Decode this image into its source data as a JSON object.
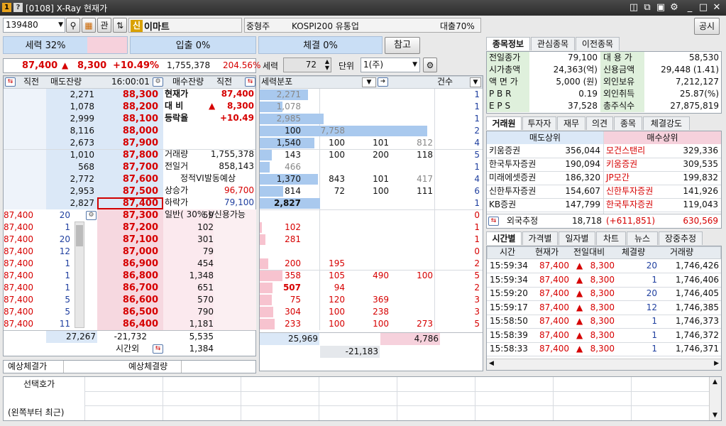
{
  "window": {
    "badge1": "1",
    "badge2": "?",
    "title": "[0108] X-Ray 현재가",
    "icons": [
      "window-pin-icon",
      "copy-icon",
      "screenshot-icon",
      "gear-icon"
    ],
    "min": "_",
    "max": "□",
    "close": "✕"
  },
  "toolbar": {
    "code": "139480",
    "gwan": "관",
    "sin_badge": "신",
    "stock_name": "이마트",
    "type": "중형주",
    "sector": "KOSPI200 유통업",
    "loan": "대출70%",
    "notice": "공시"
  },
  "power_bars": {
    "power": "세력 32%",
    "in_out": "입출 0%",
    "trade": "체결 0%",
    "ref": "참고"
  },
  "summary": {
    "price": "87,400",
    "arrow": "▲",
    "change": "8,300",
    "rate": "+10.49%",
    "volume": "1,755,378",
    "ratio": "204.56%"
  },
  "force_ctrl": {
    "label": "세력",
    "value": "72",
    "unit_label": "단위",
    "unit_value": "1(주)"
  },
  "ob_head": {
    "c1": "직전",
    "c2": "매도잔량",
    "time": "16:00:01",
    "c4": "매수잔량",
    "c5": "직전"
  },
  "asks": [
    {
      "qty": "2,271",
      "price": "88,300"
    },
    {
      "qty": "1,078",
      "price": "88,200"
    },
    {
      "qty": "2,999",
      "price": "88,100"
    },
    {
      "qty": "8,116",
      "price": "88,000"
    },
    {
      "qty": "2,673",
      "price": "87,900"
    },
    {
      "qty": "1,010",
      "price": "87,800"
    },
    {
      "qty": "568",
      "price": "87,700"
    },
    {
      "qty": "2,772",
      "price": "87,600"
    },
    {
      "qty": "2,953",
      "price": "87,500"
    },
    {
      "qty": "2,827",
      "price": "87,400"
    }
  ],
  "bids": [
    {
      "tp": "87,400",
      "tq": "20",
      "price": "87,300",
      "qty": "59"
    },
    {
      "tp": "87,400",
      "tq": "1",
      "price": "87,200",
      "qty": "102"
    },
    {
      "tp": "87,400",
      "tq": "20",
      "price": "87,100",
      "qty": "301"
    },
    {
      "tp": "87,400",
      "tq": "12",
      "price": "87,000",
      "qty": "79"
    },
    {
      "tp": "87,400",
      "tq": "1",
      "price": "86,900",
      "qty": "454"
    },
    {
      "tp": "87,400",
      "tq": "1",
      "price": "86,800",
      "qty": "1,348"
    },
    {
      "tp": "87,400",
      "tq": "1",
      "price": "86,700",
      "qty": "651"
    },
    {
      "tp": "87,400",
      "tq": "5",
      "price": "86,600",
      "qty": "570"
    },
    {
      "tp": "87,400",
      "tq": "5",
      "price": "86,500",
      "qty": "790"
    },
    {
      "tp": "87,400",
      "tq": "11",
      "price": "86,400",
      "qty": "1,181"
    }
  ],
  "ob_info": {
    "cur_label": "현재가",
    "cur_val": "87,400",
    "diff_label": "대  비",
    "diff_arrow": "▲",
    "diff_val": "8,300",
    "rate_label": "등락율",
    "rate_val": "+10.49",
    "vol_label": "거래량",
    "vol_val": "1,755,378",
    "prev_label": "전일거",
    "prev_val": "858,143",
    "vi_label": "정적VI발동예상",
    "up_label": "상승가",
    "up_val": "96,700",
    "down_label": "하락가",
    "down_val": "79,100",
    "margin_label": "일반( 30% )/신용가능"
  },
  "ob_totals": {
    "ask_total": "27,267",
    "diff": "-21,732",
    "bid_total": "5,535",
    "after_label": "시간외",
    "after_val": "1,384"
  },
  "expected": {
    "price_label": "예상체결가",
    "price_val": "",
    "qty_label": "예상체결량",
    "qty_val": ""
  },
  "dist": {
    "label": "세력분포",
    "count_label": "건수",
    "rows": [
      {
        "a": "2,271",
        "b": "",
        "c": "",
        "d": "",
        "n": "1"
      },
      {
        "a": "1,078",
        "b": "",
        "c": "",
        "d": "",
        "n": "1"
      },
      {
        "a": "2,985",
        "b": "",
        "c": "",
        "d": "",
        "n": "1"
      },
      {
        "a": "100",
        "b": "7,758",
        "c": "",
        "d": "",
        "n": "2"
      },
      {
        "a": "1,540",
        "b": "100",
        "c": "101",
        "d": "812",
        "n": "4"
      },
      {
        "a": "143",
        "b": "100",
        "c": "200",
        "d": "118",
        "n": "5"
      },
      {
        "a": "466",
        "b": "",
        "c": "",
        "d": "",
        "n": "1"
      },
      {
        "a": "1,370",
        "b": "843",
        "c": "101",
        "d": "417",
        "n": "4"
      },
      {
        "a": "814",
        "b": "72",
        "c": "100",
        "d": "111",
        "n": "6"
      },
      {
        "a": "2,827",
        "b": "",
        "c": "",
        "d": "",
        "n": "1"
      },
      {
        "a": "",
        "b": "",
        "c": "",
        "d": "",
        "n": "0"
      },
      {
        "a": "102",
        "b": "",
        "c": "",
        "d": "",
        "n": "1"
      },
      {
        "a": "281",
        "b": "",
        "c": "",
        "d": "",
        "n": "1"
      },
      {
        "a": "",
        "b": "",
        "c": "",
        "d": "",
        "n": "0"
      },
      {
        "a": "200",
        "b": "195",
        "c": "",
        "d": "",
        "n": "2"
      },
      {
        "a": "358",
        "b": "105",
        "c": "490",
        "d": "100",
        "n": "5"
      },
      {
        "a": "507",
        "b": "94",
        "c": "",
        "d": "",
        "n": "2"
      },
      {
        "a": "75",
        "b": "120",
        "c": "369",
        "d": "",
        "n": "3"
      },
      {
        "a": "304",
        "b": "100",
        "c": "238",
        "d": "",
        "n": "3"
      },
      {
        "a": "233",
        "b": "100",
        "c": "100",
        "d": "273",
        "n": "5"
      }
    ],
    "total_ask": "25,969",
    "total_bid": "4,786",
    "total_diff": "-21,183"
  },
  "info_tabs": [
    "종목정보",
    "관심종목",
    "이전종목"
  ],
  "info": [
    {
      "l1": "전일종가",
      "v1": "79,100",
      "l2": "대 용 가",
      "v2": "58,530"
    },
    {
      "l1": "시가총액",
      "v1": "24,363(억)",
      "l2": "신용금액",
      "v2": "29,448  (1.41)"
    },
    {
      "l1": "액 면 가",
      "v1": "5,000 (원)",
      "l2": "외인보유",
      "v2": "7,212,127"
    },
    {
      "l1": "P B R",
      "v1": "0.19",
      "l2": "외인취득",
      "v2": "25.87(%)"
    },
    {
      "l1": "E P S",
      "v1": "37,528",
      "l2": "총주식수",
      "v2": "27,875,819"
    }
  ],
  "broker_tabs": [
    "거래원",
    "투자자",
    "재무",
    "의견",
    "종목",
    "체결강도"
  ],
  "broker": {
    "sell_head": "매도상위",
    "buy_head": "매수상위",
    "rows": [
      {
        "sn": "키움증권",
        "sv": "356,044",
        "bn": "모건스탠리",
        "bv": "329,336"
      },
      {
        "sn": "한국투자증권",
        "sv": "190,094",
        "bn": "키움증권",
        "bv": "309,535"
      },
      {
        "sn": "미래에셋증권",
        "sv": "186,320",
        "bn": "JP모간",
        "bv": "199,832"
      },
      {
        "sn": "신한투자증권",
        "sv": "154,607",
        "bn": "신한투자증권",
        "bv": "141,926"
      },
      {
        "sn": "KB증권",
        "sv": "147,799",
        "bn": "한국투자증권",
        "bv": "119,043"
      }
    ],
    "foreign_label": "외국추정",
    "foreign_sell": "18,718",
    "foreign_diff": "(+611,851)",
    "foreign_buy": "630,569"
  },
  "time_tabs": [
    "시간별",
    "가격별",
    "일자별",
    "차트",
    "뉴스",
    "장중추정"
  ],
  "time_head": {
    "t": "시간",
    "p": "현재가",
    "d": "전일대비",
    "q": "체결량",
    "v": "거래량"
  },
  "time_rows": [
    {
      "t": "15:59:34",
      "p": "87,400",
      "d": "8,300",
      "q": "20",
      "v": "1,746,426"
    },
    {
      "t": "15:59:34",
      "p": "87,400",
      "d": "8,300",
      "q": "1",
      "v": "1,746,406"
    },
    {
      "t": "15:59:20",
      "p": "87,400",
      "d": "8,300",
      "q": "20",
      "v": "1,746,405"
    },
    {
      "t": "15:59:17",
      "p": "87,400",
      "d": "8,300",
      "q": "12",
      "v": "1,746,385"
    },
    {
      "t": "15:58:50",
      "p": "87,400",
      "d": "8,300",
      "q": "1",
      "v": "1,746,373"
    },
    {
      "t": "15:58:39",
      "p": "87,400",
      "d": "8,300",
      "q": "1",
      "v": "1,746,372"
    },
    {
      "t": "15:58:33",
      "p": "87,400",
      "d": "8,300",
      "q": "1",
      "v": "1,746,371"
    }
  ],
  "bottom": {
    "select_label": "선택호가",
    "recent_label": "(왼쪽부터 최근)"
  }
}
